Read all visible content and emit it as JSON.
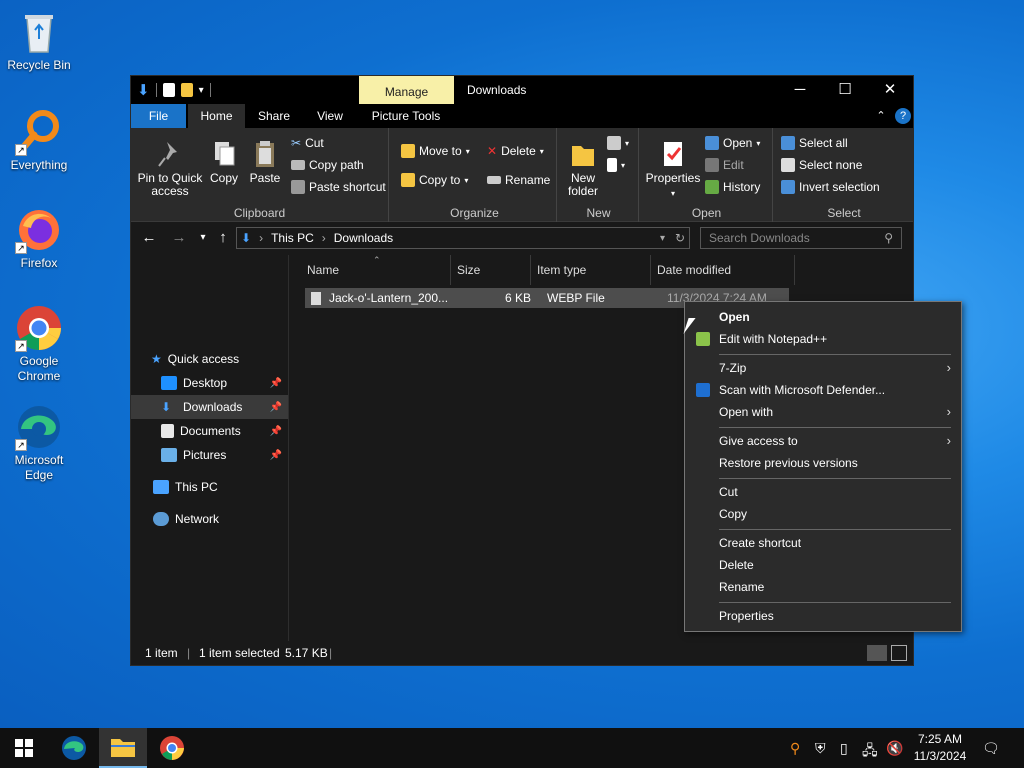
{
  "desktop": {
    "icons": [
      {
        "label": "Recycle Bin"
      },
      {
        "label": "Everything"
      },
      {
        "label": "Firefox"
      },
      {
        "label": "Google Chrome"
      },
      {
        "label": "Microsoft Edge"
      }
    ]
  },
  "window": {
    "title": "Downloads",
    "manage_tab": "Manage",
    "picture_tools_tab": "Picture Tools",
    "ribbon_tabs": [
      "File",
      "Home",
      "Share",
      "View"
    ],
    "clipboard": {
      "pin": "Pin to Quick access",
      "copy": "Copy",
      "paste": "Paste",
      "cut": "Cut",
      "copy_path": "Copy path",
      "paste_shortcut": "Paste shortcut",
      "label": "Clipboard"
    },
    "organize": {
      "move_to": "Move to",
      "copy_to": "Copy to",
      "delete": "Delete",
      "rename": "Rename",
      "label": "Organize"
    },
    "new": {
      "new_folder": "New folder",
      "label": "New"
    },
    "open": {
      "properties": "Properties",
      "open": "Open",
      "edit": "Edit",
      "history": "History",
      "label": "Open"
    },
    "select": {
      "select_all": "Select all",
      "select_none": "Select none",
      "invert": "Invert selection",
      "label": "Select"
    },
    "breadcrumb": [
      "This PC",
      "Downloads"
    ],
    "search_placeholder": "Search Downloads",
    "nav": {
      "quick_access": "Quick access",
      "desktop": "Desktop",
      "downloads": "Downloads",
      "documents": "Documents",
      "pictures": "Pictures",
      "this_pc": "This PC",
      "network": "Network"
    },
    "columns": [
      "Name",
      "Size",
      "Item type",
      "Date modified"
    ],
    "file": {
      "name": "Jack-o'-Lantern_200...",
      "size": "6 KB",
      "type": "WEBP File",
      "date": "11/3/2024 7:24 AM"
    },
    "status": {
      "count": "1 item",
      "selected": "1 item selected",
      "size": "5.17 KB"
    }
  },
  "context_menu": {
    "open": "Open",
    "edit_npp": "Edit with Notepad++",
    "sevenzip": "7-Zip",
    "defender": "Scan with Microsoft Defender...",
    "open_with": "Open with",
    "give_access": "Give access to",
    "restore": "Restore previous versions",
    "cut": "Cut",
    "copy": "Copy",
    "create_shortcut": "Create shortcut",
    "delete": "Delete",
    "rename": "Rename",
    "properties": "Properties"
  },
  "taskbar": {
    "time": "7:25 AM",
    "date": "11/3/2024"
  }
}
